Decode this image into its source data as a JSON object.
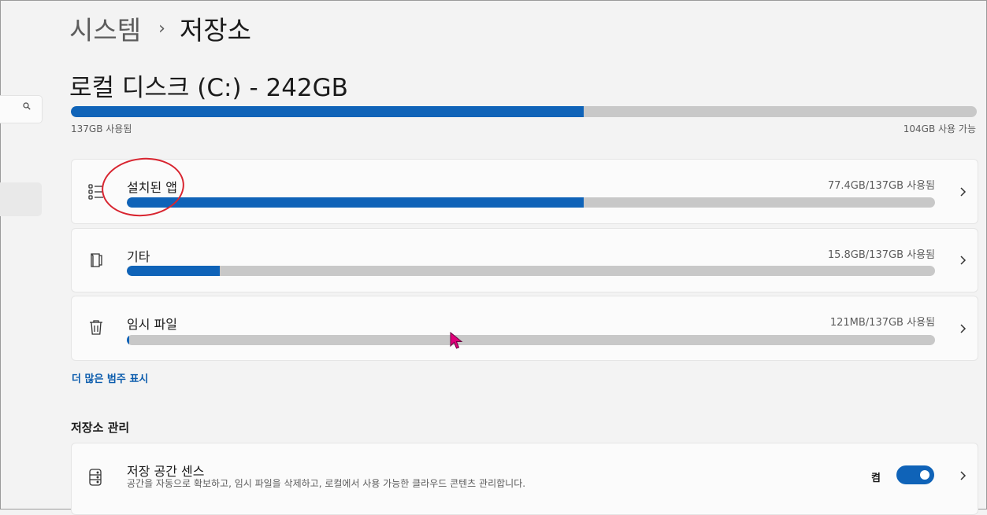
{
  "breadcrumb": {
    "parent": "시스템",
    "separator": "›",
    "current": "저장소"
  },
  "disk": {
    "title": "로컬 디스크 (C:) - 242GB",
    "used_label": "137GB 사용됨",
    "free_label": "104GB 사용 가능",
    "used_fraction": 0.5657
  },
  "categories": [
    {
      "name": "설치된 앱",
      "size_label": "77.4GB/137GB 사용됨",
      "used_fraction": 0.565,
      "icon": "apps-list-icon"
    },
    {
      "name": "기타",
      "size_label": "15.8GB/137GB 사용됨",
      "used_fraction": 0.115,
      "icon": "other-files-icon"
    },
    {
      "name": "임시 파일",
      "size_label": "121MB/137GB 사용됨",
      "used_fraction": 0.003,
      "icon": "trash-icon"
    }
  ],
  "more_categories_link": "더 많은 범주 표시",
  "management": {
    "title": "저장소 관리",
    "storage_sense": {
      "title": "저장 공간 센스",
      "description": "공간을 자동으로 확보하고, 임시 파일을 삭제하고, 로컬에서 사용 가능한 클라우드 콘텐츠 관리합니다.",
      "toggle_label": "켬",
      "enabled": true,
      "icon": "storage-drive-icon"
    }
  },
  "colors": {
    "accent": "#0f63b8",
    "bar_track": "#c8c8c8",
    "annotation": "#d8242f",
    "cursor": "#e0007a"
  }
}
